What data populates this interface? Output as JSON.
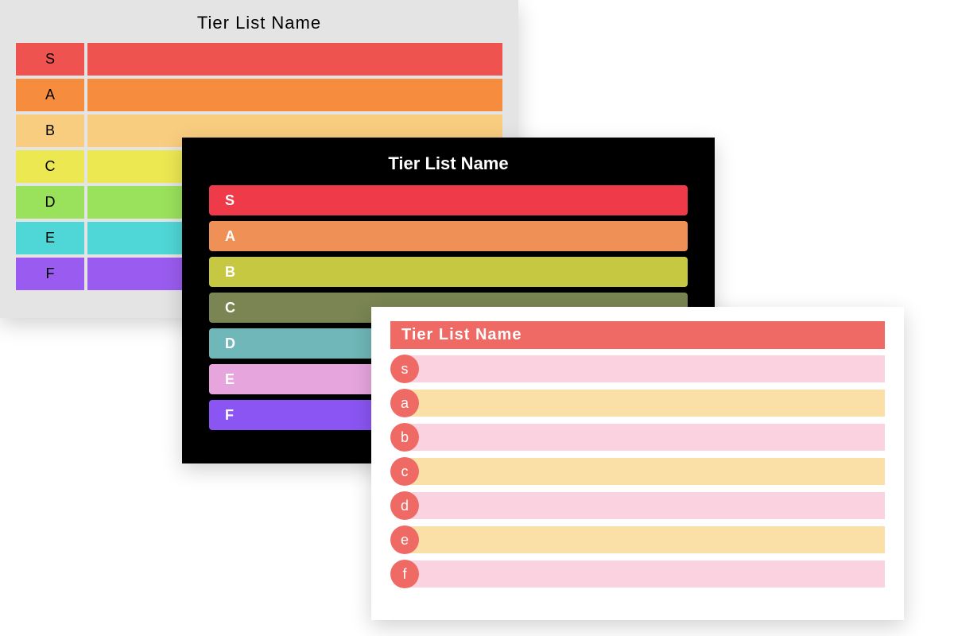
{
  "card1": {
    "title": "Tier List Name",
    "tiers": [
      {
        "label": "S",
        "color": "#ef5350"
      },
      {
        "label": "A",
        "color": "#f68c3e"
      },
      {
        "label": "B",
        "color": "#f9cd7f"
      },
      {
        "label": "C",
        "color": "#ece852"
      },
      {
        "label": "D",
        "color": "#9ae25b"
      },
      {
        "label": "E",
        "color": "#4fd6d6"
      },
      {
        "label": "F",
        "color": "#9a5cf0"
      }
    ]
  },
  "card2": {
    "title": "Tier List Name",
    "tiers": [
      {
        "label": "S",
        "color": "#ef3a4a"
      },
      {
        "label": "A",
        "color": "#ef9057"
      },
      {
        "label": "B",
        "color": "#c7c842"
      },
      {
        "label": "C",
        "color": "#7a8553"
      },
      {
        "label": "D",
        "color": "#6fb7b8"
      },
      {
        "label": "E",
        "color": "#e6a5dd"
      },
      {
        "label": "F",
        "color": "#8a55f2"
      }
    ]
  },
  "card3": {
    "title": "Tier List Name",
    "circle_color": "#ef6a64",
    "body_colors": [
      "#fbd3e0",
      "#fadfa6"
    ],
    "tiers": [
      {
        "label": "s"
      },
      {
        "label": "a"
      },
      {
        "label": "b"
      },
      {
        "label": "c"
      },
      {
        "label": "d"
      },
      {
        "label": "e"
      },
      {
        "label": "f"
      }
    ]
  }
}
